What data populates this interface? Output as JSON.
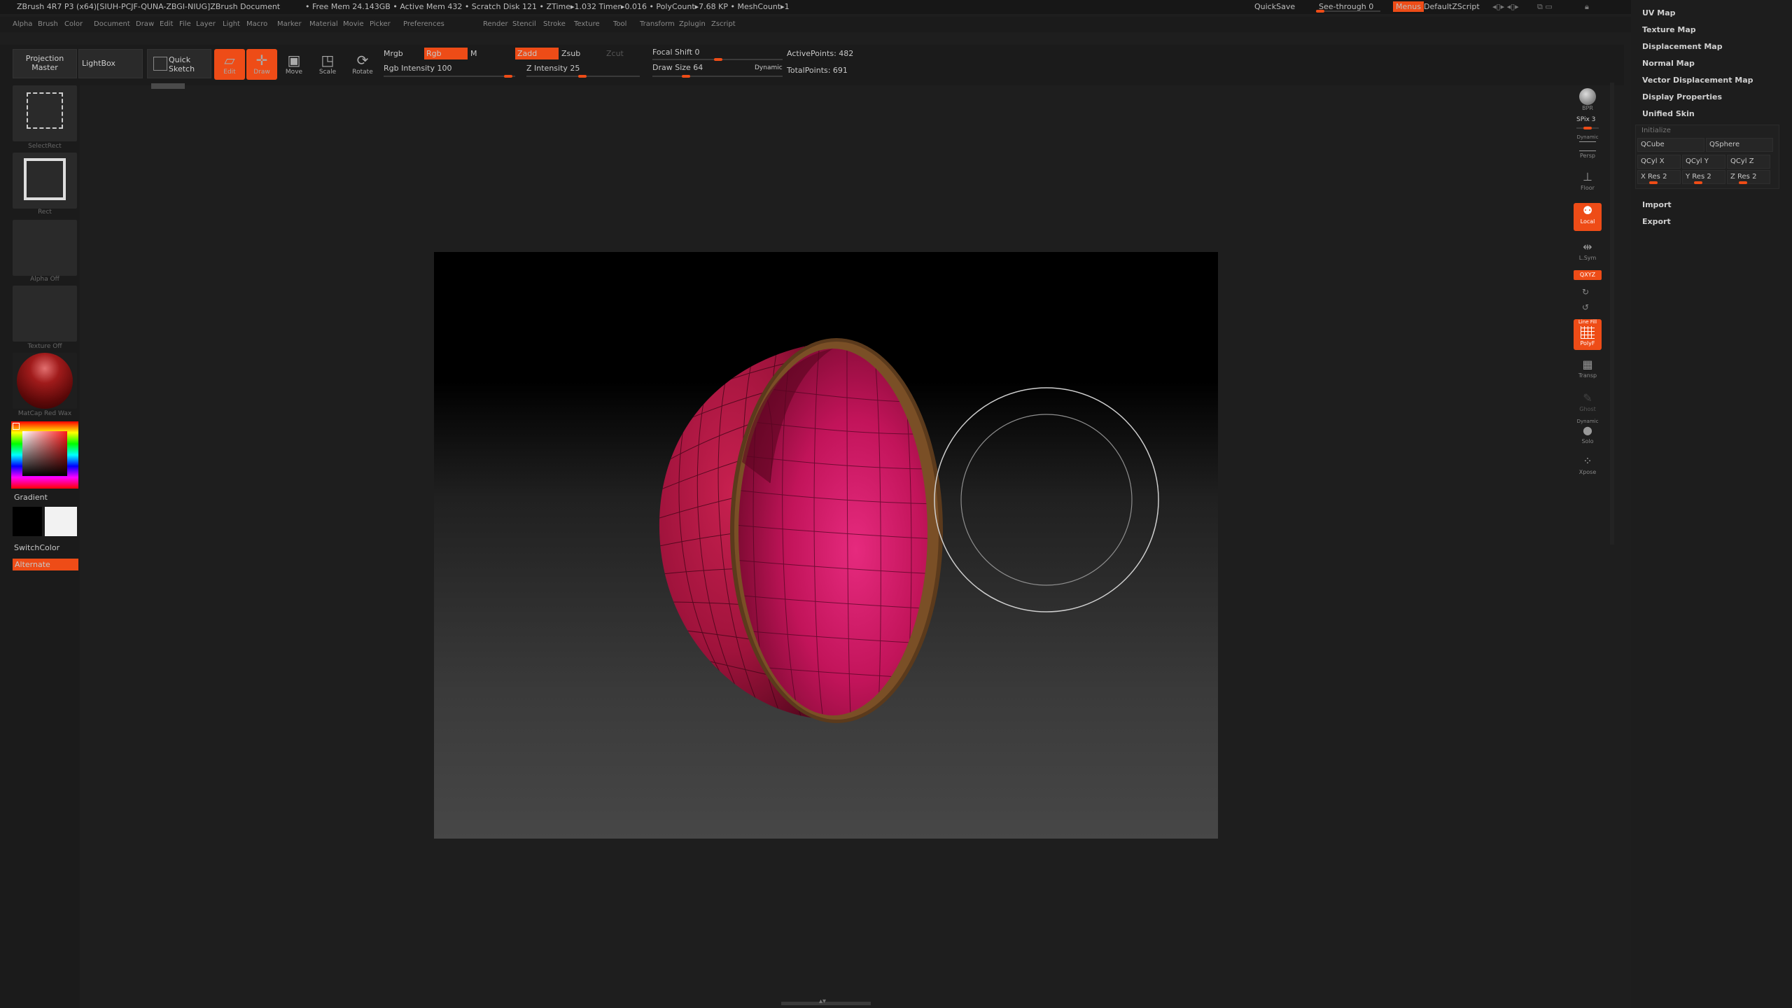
{
  "title_bar": {
    "app": "ZBrush 4R7 P3 (x64)[SIUH-PCJF-QUNA-ZBGI-NIUG]ZBrush Document",
    "stats": "• Free Mem 24.143GB • Active Mem 432 • Scratch Disk 121 • ZTime▸1.032 Timer▸0.016 • PolyCount▸7.68 KP • MeshCount▸1",
    "quicksave": "QuickSave",
    "see_through": "See-through 0",
    "menus": "Menus",
    "script": "DefaultZScript"
  },
  "menu_items": [
    "Alpha",
    "Brush",
    "Color",
    "Document",
    "Draw",
    "Edit",
    "File",
    "Layer",
    "Light",
    "Macro",
    "Marker",
    "Material",
    "Movie",
    "Picker",
    "Preferences",
    "Render",
    "Stencil",
    "Stroke",
    "Texture",
    "Tool",
    "Transform",
    "Zplugin",
    "Zscript"
  ],
  "shelf": {
    "projection_master": "Projection Master",
    "lightbox": "LightBox",
    "quick_sketch": "Quick Sketch",
    "edit": "Edit",
    "draw": "Draw",
    "move": "Move",
    "scale": "Scale",
    "rotate": "Rotate",
    "mrgb": "Mrgb",
    "rgb": "Rgb",
    "m": "M",
    "zadd": "Zadd",
    "zsub": "Zsub",
    "zcut": "Zcut",
    "rgb_intensity": "Rgb Intensity 100",
    "z_intensity": "Z Intensity 25",
    "focal_shift": "Focal Shift 0",
    "draw_size": "Draw Size 64",
    "dynamic": "Dynamic",
    "active_points": "ActivePoints: 482",
    "total_points": "TotalPoints: 691"
  },
  "left_tray": {
    "alpha_brush": "SelectRect",
    "stroke": "Rect",
    "alpha": "Alpha Off",
    "texture": "Texture Off",
    "material": "MatCap Red Wax",
    "gradient": "Gradient",
    "switchcolor": "SwitchColor",
    "alternate": "Alternate"
  },
  "right_shelf": {
    "bpr": "BPR",
    "spix": "SPix 3",
    "dynamic": "Dynamic",
    "persp": "Persp",
    "floor": "Floor",
    "local": "Local",
    "lsym": "L.Sym",
    "xyz": "QXYZ",
    "line_fill": "Line Fill",
    "polyf": "PolyF",
    "transp": "Transp",
    "ghost": "Ghost",
    "solo": "Solo",
    "dynamic2": "Dynamic",
    "xpose": "Xpose"
  },
  "palette": {
    "items_top": [
      "UV Map",
      "Texture Map",
      "Displacement Map",
      "Normal Map",
      "Vector Displacement Map",
      "Display Properties",
      "Unified Skin"
    ],
    "initialize": "Initialize",
    "qcube": "QCube",
    "qsphere": "QSphere",
    "qcyl_x": "QCyl X",
    "qcyl_y": "QCyl Y",
    "qcyl_z": "QCyl Z",
    "x_res": "X Res 2",
    "y_res": "Y Res 2",
    "z_res": "Z Res 2",
    "import": "Import",
    "export": "Export"
  },
  "colors": {
    "accent": "#ee4c17",
    "mesh": "#c0174e"
  }
}
